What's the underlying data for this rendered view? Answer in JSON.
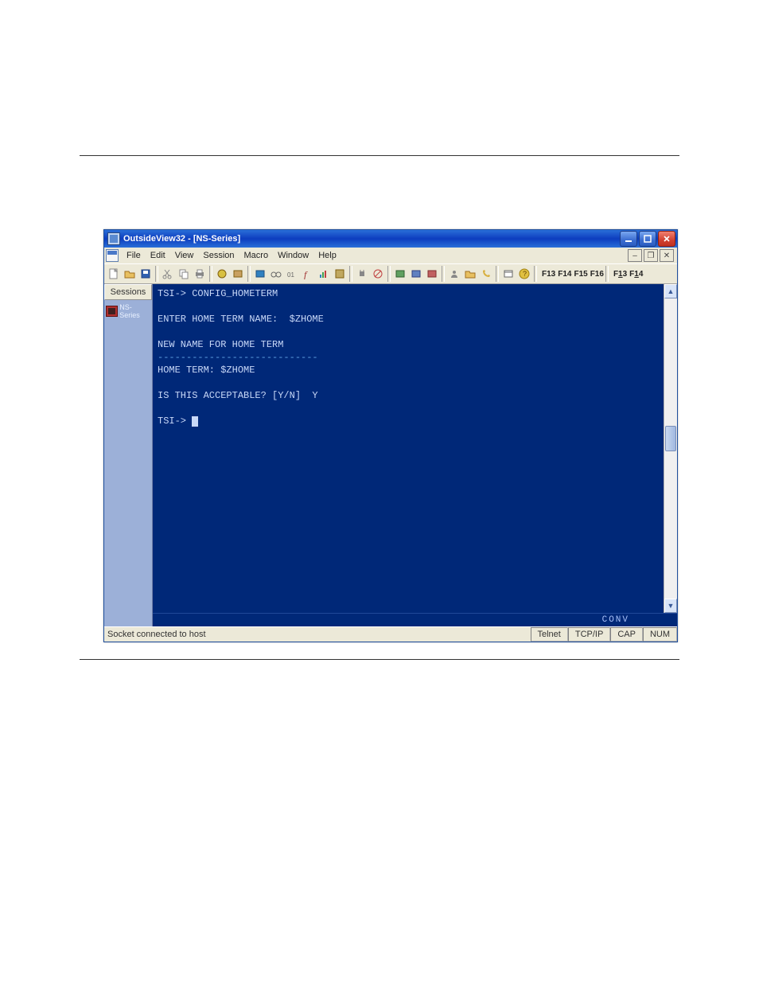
{
  "window": {
    "title": "OutsideView32 - [NS-Series]"
  },
  "menu": {
    "items": [
      "File",
      "Edit",
      "View",
      "Session",
      "Macro",
      "Window",
      "Help"
    ]
  },
  "fkeys_left": [
    "F13",
    "F14",
    "F15",
    "F16"
  ],
  "fkeys_right": [
    "F13",
    "F14"
  ],
  "sidebar": {
    "tab_label": "Sessions",
    "session_label": "NS-Series"
  },
  "terminal": {
    "lines": [
      "TSI-> CONFIG_HOMETERM",
      "",
      "ENTER HOME TERM NAME:  $ZHOME",
      "",
      "NEW NAME FOR HOME TERM",
      "----------------------------",
      "HOME TERM: $ZHOME",
      "",
      "IS THIS ACCEPTABLE? [Y/N]  Y",
      "",
      "TSI-> "
    ],
    "status_word": "CONV"
  },
  "statusbar": {
    "message": "Socket connected to host",
    "conn": "Telnet",
    "proto": "TCP/IP",
    "ind1": "CAP",
    "ind2": "NUM"
  }
}
